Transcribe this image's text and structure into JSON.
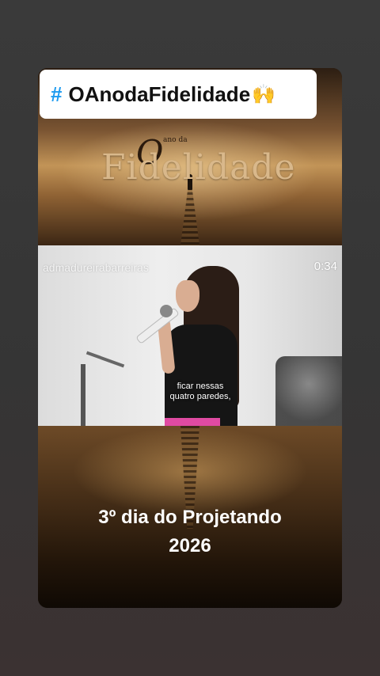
{
  "hashtag": {
    "symbol": "#",
    "text": "OAnodaFidelidade",
    "emoji": "🙌"
  },
  "banner": {
    "small_title": "O",
    "tiny_text": "ano da",
    "big_title": "Fidelidade"
  },
  "video": {
    "account": "admadureirabarreiras",
    "duration": "0:34",
    "caption_line1": "ficar nessas",
    "caption_line2": "quatro paredes,"
  },
  "footer": {
    "line1": "3º dia do Projetando",
    "line2": "2026"
  },
  "colors": {
    "hashtag_accent": "#1d9bf0",
    "background": "#363636"
  }
}
